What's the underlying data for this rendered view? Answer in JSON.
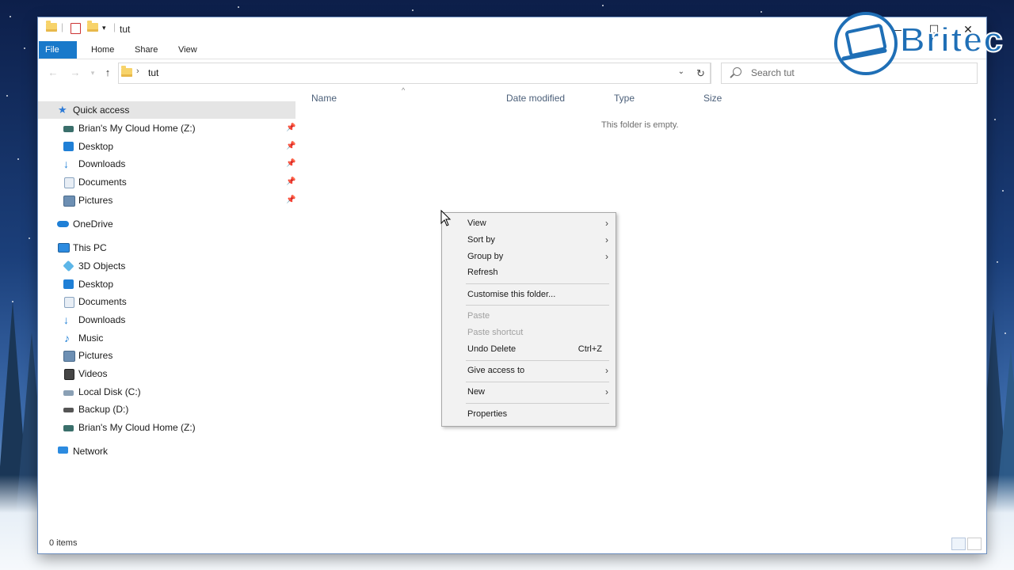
{
  "window": {
    "title": "tut",
    "controls": {
      "minimize": "—",
      "maximize": "☐",
      "close": "✕"
    }
  },
  "ribbon": {
    "tabs": [
      "File",
      "Home",
      "Share",
      "View"
    ]
  },
  "address": {
    "separator": "›",
    "path": "tut"
  },
  "search": {
    "placeholder": "Search tut"
  },
  "nav": {
    "quick_access": "Quick access",
    "quick_items": [
      "Brian's My Cloud Home (Z:)",
      "Desktop",
      "Downloads",
      "Documents",
      "Pictures"
    ],
    "onedrive": "OneDrive",
    "this_pc": "This PC",
    "pc_items": [
      "3D Objects",
      "Desktop",
      "Documents",
      "Downloads",
      "Music",
      "Pictures",
      "Videos",
      "Local Disk (C:)",
      "Backup (D:)",
      "Brian's My Cloud Home (Z:)"
    ],
    "network": "Network"
  },
  "columns": [
    "Name",
    "Date modified",
    "Type",
    "Size"
  ],
  "empty_message": "This folder is empty.",
  "status": {
    "items": "0 items"
  },
  "context_menu": {
    "view": "View",
    "sort_by": "Sort by",
    "group_by": "Group by",
    "refresh": "Refresh",
    "customise": "Customise this folder...",
    "paste": "Paste",
    "paste_shortcut": "Paste shortcut",
    "undo_delete": "Undo Delete",
    "undo_shortcut": "Ctrl+Z",
    "give_access": "Give access to",
    "new": "New",
    "properties": "Properties"
  },
  "logo": {
    "text": "Britec"
  },
  "colors": {
    "accent": "#1979ca",
    "logo_blue": "#1f6fb6"
  }
}
